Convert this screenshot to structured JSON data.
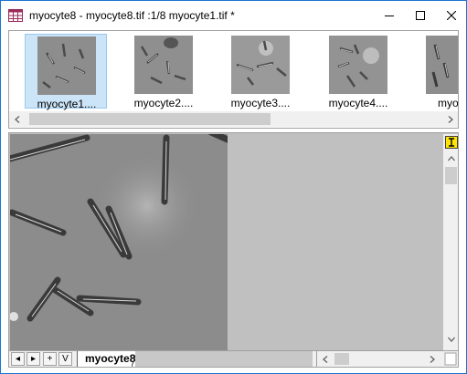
{
  "window": {
    "title": "myocyte8 - myocyte8.tif :1/8 myocyte1.tif *",
    "icons": {
      "app": "grid-window-icon",
      "minimize": "minimize-icon",
      "maximize": "maximize-icon",
      "close": "close-icon"
    }
  },
  "thumbnails": [
    {
      "label": "myocyte1....",
      "selected": true
    },
    {
      "label": "myocyte2....",
      "selected": false
    },
    {
      "label": "myocyte3....",
      "selected": false
    },
    {
      "label": "myocyte4....",
      "selected": false
    },
    {
      "label": "myocyt",
      "selected": false
    }
  ],
  "sheet": {
    "tab_label": "myocyte8",
    "nav": {
      "first": "◂",
      "prev": "▸",
      "add": "+",
      "menu": "V"
    }
  },
  "colors": {
    "accent": "#1a73d0",
    "selected_bg": "#cce4f7",
    "lock": "#ffe400"
  }
}
